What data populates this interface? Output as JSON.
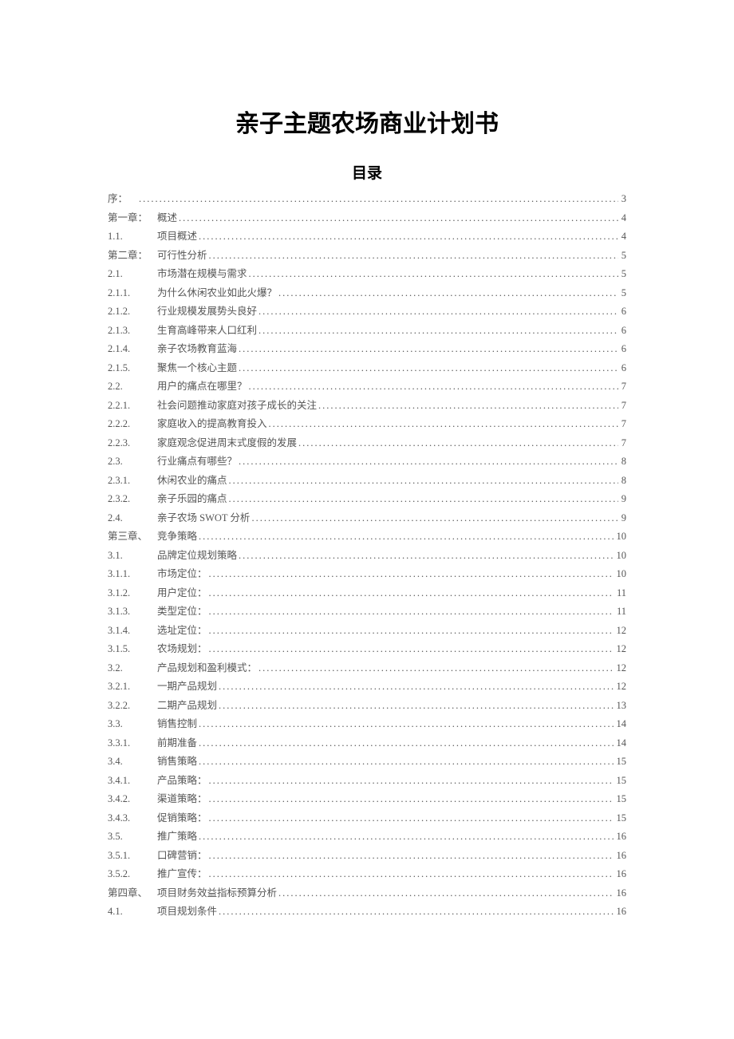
{
  "title": "亲子主题农场商业计划书",
  "tocTitle": "目录",
  "toc": [
    {
      "section": "序：",
      "label": "",
      "page": "3",
      "indent": 0
    },
    {
      "section": "第一章：",
      "label": "概述",
      "page": "4",
      "indent": 0
    },
    {
      "section": "1.1.",
      "label": "项目概述",
      "page": "4",
      "indent": 1
    },
    {
      "section": "第二章：",
      "label": "可行性分析",
      "page": "5",
      "indent": 0
    },
    {
      "section": "2.1.",
      "label": "市场潜在规模与需求",
      "page": "5",
      "indent": 1
    },
    {
      "section": "2.1.1.",
      "label": "为什么休闲农业如此火爆？",
      "page": "5",
      "indent": 2
    },
    {
      "section": "2.1.2.",
      "label": "行业规模发展势头良好",
      "page": "6",
      "indent": 2
    },
    {
      "section": "2.1.3.",
      "label": "生育高峰带来人口红利",
      "page": "6",
      "indent": 2
    },
    {
      "section": "2.1.4.",
      "label": "亲子农场教育蓝海",
      "page": "6",
      "indent": 2
    },
    {
      "section": "2.1.5.",
      "label": "聚焦一个核心主题",
      "page": "6",
      "indent": 2
    },
    {
      "section": "2.2.",
      "label": "用户的痛点在哪里？",
      "page": "7",
      "indent": 1
    },
    {
      "section": "2.2.1.",
      "label": "社会问题推动家庭对孩子成长的关注",
      "page": "7",
      "indent": 2
    },
    {
      "section": "2.2.2.",
      "label": "家庭收入的提高教育投入",
      "page": "7",
      "indent": 1
    },
    {
      "section": "2.2.3.",
      "label": "家庭观念促进周末式度假的发展",
      "page": "7",
      "indent": 1
    },
    {
      "section": "2.3.",
      "label": "行业痛点有哪些？",
      "page": "8",
      "indent": 1
    },
    {
      "section": "2.3.1.",
      "label": "休闲农业的痛点",
      "page": "8",
      "indent": 1
    },
    {
      "section": "2.3.2.",
      "label": "亲子乐园的痛点",
      "page": "9",
      "indent": 1
    },
    {
      "section": "2.4.",
      "label": "亲子农场 SWOT 分析",
      "page": "9",
      "indent": 1
    },
    {
      "section": "第三章、",
      "label": "竞争策略",
      "page": "10",
      "indent": 0
    },
    {
      "section": "3.1.",
      "label": "品牌定位规划策略",
      "page": "10",
      "indent": 1
    },
    {
      "section": "3.1.1.",
      "label": "市场定位：",
      "page": "10",
      "indent": 1
    },
    {
      "section": "3.1.2.",
      "label": "用户定位：",
      "page": "11",
      "indent": 1
    },
    {
      "section": "3.1.3.",
      "label": "类型定位：",
      "page": "11",
      "indent": 1
    },
    {
      "section": "3.1.4.",
      "label": "选址定位：",
      "page": "12",
      "indent": 1
    },
    {
      "section": "3.1.5.",
      "label": "农场规划：",
      "page": "12",
      "indent": 2
    },
    {
      "section": "3.2.",
      "label": "产品规划和盈利模式：",
      "page": "12",
      "indent": 1
    },
    {
      "section": "3.2.1.",
      "label": "一期产品规划",
      "page": "12",
      "indent": 1
    },
    {
      "section": "3.2.2.",
      "label": "二期产品规划",
      "page": "13",
      "indent": 1
    },
    {
      "section": "3.3.",
      "label": "销售控制",
      "page": "14",
      "indent": 1
    },
    {
      "section": "3.3.1.",
      "label": "前期准备",
      "page": "14",
      "indent": 1
    },
    {
      "section": "3.4.",
      "label": "销售策略",
      "page": "15",
      "indent": 1
    },
    {
      "section": "3.4.1.",
      "label": "产品策略：",
      "page": "15",
      "indent": 1
    },
    {
      "section": "3.4.2.",
      "label": "渠道策略：",
      "page": "15",
      "indent": 1
    },
    {
      "section": "3.4.3.",
      "label": "促销策略：",
      "page": "15",
      "indent": 1
    },
    {
      "section": "3.5.",
      "label": "推广策略",
      "page": "16",
      "indent": 1
    },
    {
      "section": "3.5.1.",
      "label": "口碑营销：",
      "page": "16",
      "indent": 1
    },
    {
      "section": "3.5.2.",
      "label": "推广宣传：",
      "page": "16",
      "indent": 1
    },
    {
      "section": "第四章、",
      "label": "项目财务效益指标预算分析",
      "page": "16",
      "indent": 0
    },
    {
      "section": "4.1.",
      "label": "项目规划条件",
      "page": "16",
      "indent": 1
    }
  ]
}
